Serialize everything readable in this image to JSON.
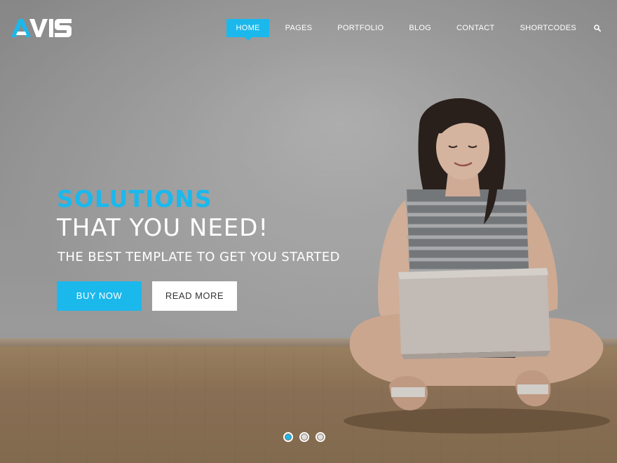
{
  "brand": {
    "logo_text": "AVIS",
    "accent_color": "#1bb8ec"
  },
  "nav": {
    "items": [
      {
        "label": "HOME",
        "active": true
      },
      {
        "label": "PAGES",
        "active": false
      },
      {
        "label": "PORTFOLIO",
        "active": false
      },
      {
        "label": "BLOG",
        "active": false
      },
      {
        "label": "CONTACT",
        "active": false
      },
      {
        "label": "SHORTCODES",
        "active": false
      }
    ],
    "search_icon": "search-icon"
  },
  "hero": {
    "headline_accent": "SOLUTIONS",
    "headline_main": "THAT YOU NEED!",
    "subheadline": "THE BEST TEMPLATE TO GET YOU STARTED",
    "buttons": {
      "primary_label": "BUY NOW",
      "secondary_label": "READ MORE"
    },
    "image_subject": "woman-with-laptop"
  },
  "slider": {
    "slide_count": 3,
    "active_index": 0
  }
}
